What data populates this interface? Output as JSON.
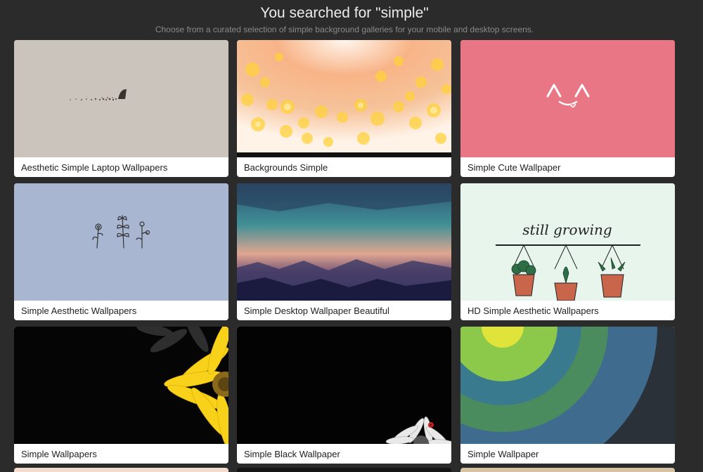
{
  "page": {
    "title": "You searched for \"simple\"",
    "subtitle": "Choose from a curated selection of simple background galleries for your mobile and desktop screens."
  },
  "gallery": [
    {
      "label": "Aesthetic Simple Laptop Wallpapers",
      "thumb": "minimal-beige-fin"
    },
    {
      "label": "Backgrounds Simple",
      "thumb": "golden-bokeh"
    },
    {
      "label": "Simple Cute Wallpaper",
      "thumb": "pink-cute-face"
    },
    {
      "label": "Simple Aesthetic Wallpapers",
      "thumb": "blue-botanical-sketch"
    },
    {
      "label": "Simple Desktop Wallpaper Beautiful",
      "thumb": "lowpoly-sunset"
    },
    {
      "label": "HD Simple Aesthetic Wallpapers",
      "thumb": "still-growing-plants"
    },
    {
      "label": "Simple Wallpapers",
      "thumb": "yellow-flower-black"
    },
    {
      "label": "Simple Black Wallpaper",
      "thumb": "daisy-ladybug-black"
    },
    {
      "label": "Simple Wallpaper",
      "thumb": "concentric-arcs"
    }
  ],
  "thumb_text": {
    "still_growing": "still growing"
  },
  "colors": {
    "page_background": "#2b2b2b",
    "card_background": "#ffffff",
    "caption_text": "#222222"
  }
}
